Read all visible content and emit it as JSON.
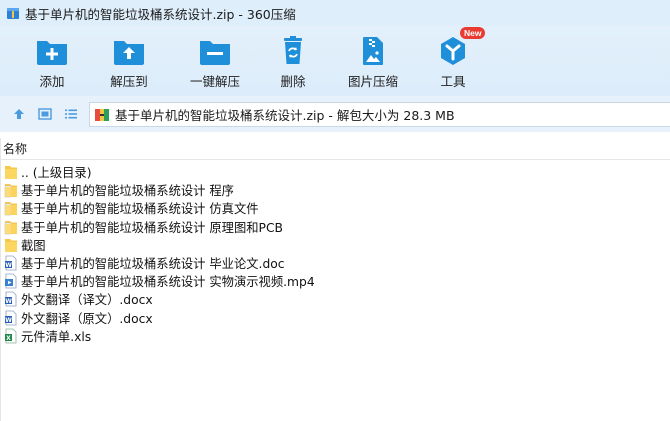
{
  "window": {
    "title": "基于单片机的智能垃圾桶系统设计.zip - 360压缩"
  },
  "toolbar": {
    "items": [
      {
        "label": "添加",
        "icon": "add-folder-icon"
      },
      {
        "label": "解压到",
        "icon": "extract-to-icon"
      },
      {
        "label": "一键解压",
        "icon": "one-click-extract-icon"
      },
      {
        "label": "删除",
        "icon": "recycle-bin-icon"
      },
      {
        "label": "图片压缩",
        "icon": "image-compress-icon"
      },
      {
        "label": "工具",
        "icon": "toolbox-icon",
        "badge": "New"
      }
    ]
  },
  "navbar": {
    "path": "基于单片机的智能垃圾桶系统设计.zip - 解包大小为 28.3 MB"
  },
  "list": {
    "header": "名称",
    "items": [
      {
        "name": ".. (上级目录)",
        "type": "folder"
      },
      {
        "name": "基于单片机的智能垃圾桶系统设计 程序",
        "type": "folder-doc"
      },
      {
        "name": "基于单片机的智能垃圾桶系统设计 仿真文件",
        "type": "folder-doc"
      },
      {
        "name": "基于单片机的智能垃圾桶系统设计 原理图和PCB",
        "type": "folder-doc"
      },
      {
        "name": "截图",
        "type": "folder"
      },
      {
        "name": "基于单片机的智能垃圾桶系统设计 毕业论文.doc",
        "type": "word"
      },
      {
        "name": "基于单片机的智能垃圾桶系统设计 实物演示视频.mp4",
        "type": "video"
      },
      {
        "name": "外文翻译（译文）.docx",
        "type": "word"
      },
      {
        "name": "外文翻译（原文）.docx",
        "type": "word"
      },
      {
        "name": "元件清单.xls",
        "type": "excel"
      }
    ]
  },
  "colors": {
    "accent": "#1e8fd8",
    "toolbar_bg": "#dcecfa",
    "folder": "#f7c94b",
    "badge": "#e83b32"
  }
}
